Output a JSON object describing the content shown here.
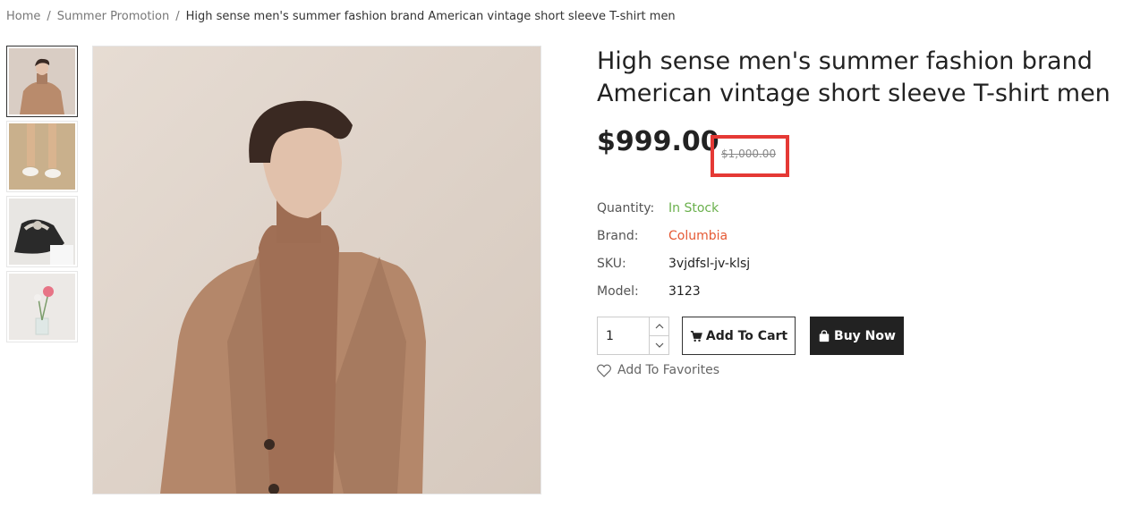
{
  "breadcrumb": {
    "home": "Home",
    "category": "Summer Promotion",
    "current": "High sense men's summer fashion brand American vintage short sleeve T-shirt men"
  },
  "product": {
    "title": "High sense men's summer fashion brand American vintage short sleeve T-shirt men",
    "price": "$999.00",
    "old_price": "$1,000.00"
  },
  "specs": {
    "quantity_label": "Quantity:",
    "quantity_value": "In Stock",
    "brand_label": "Brand:",
    "brand_value": "Columbia",
    "sku_label": "SKU:",
    "sku_value": "3vjdfsl-jv-klsj",
    "model_label": "Model:",
    "model_value": "3123"
  },
  "actions": {
    "quantity": "1",
    "add_to_cart": "Add To Cart",
    "buy_now": "Buy Now",
    "add_to_favorites": "Add To Favorites"
  },
  "icons": {
    "cart": "cart-icon",
    "bag": "shopping-bag-icon",
    "heart": "heart-icon",
    "up": "chevron-up-icon",
    "down": "chevron-down-icon"
  },
  "colors": {
    "in_stock": "#6ab04c",
    "brand": "#e55934",
    "highlight_box": "#e53935",
    "buy_button": "#222222"
  }
}
